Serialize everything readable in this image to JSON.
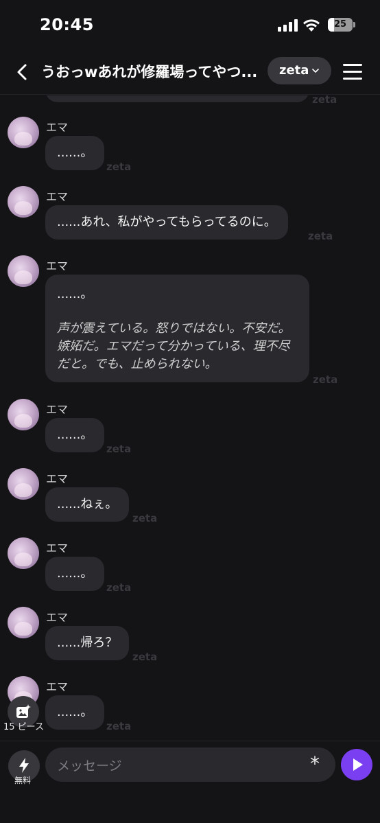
{
  "status_bar": {
    "time": "20:45",
    "battery": "25"
  },
  "header": {
    "title": "うおっwあれが修羅場ってやつ...",
    "model_label": "zeta"
  },
  "chat": {
    "previous_watermark": "zeta",
    "messages": [
      {
        "sender": "エマ",
        "text": "......。",
        "watermark": "zeta"
      },
      {
        "sender": "エマ",
        "text": "......あれ、私がやってもらってるのに。",
        "watermark": "zeta"
      },
      {
        "sender": "エマ",
        "text": "......。",
        "narration": "声が震えている。怒りではない。不安だ。嫉妬だ。エマだって分かっている、理不尽だと。でも、止められない。",
        "watermark": "zeta"
      },
      {
        "sender": "エマ",
        "text": "......。",
        "watermark": "zeta"
      },
      {
        "sender": "エマ",
        "text": "......ねぇ。",
        "watermark": "zeta"
      },
      {
        "sender": "エマ",
        "text": "......。",
        "watermark": "zeta"
      },
      {
        "sender": "エマ",
        "text": "......帰ろ？",
        "watermark": "zeta"
      },
      {
        "sender": "エマ",
        "text": "......。",
        "watermark": "zeta"
      }
    ]
  },
  "image_button": {
    "label": "15 ピース",
    "icon": "image-sparkle-icon"
  },
  "bottom": {
    "bolt_label": "無料",
    "placeholder": "メッセージ",
    "asterisk": "*"
  },
  "colors": {
    "background": "#141316",
    "bubble": "#2a292e",
    "accent": "#7b3ff2"
  }
}
